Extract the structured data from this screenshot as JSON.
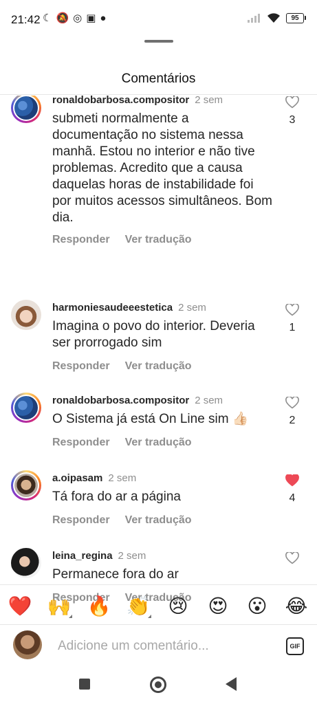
{
  "status_bar": {
    "time": "21:42",
    "left_icons": [
      "moon-icon",
      "mute-icon",
      "whatsapp-icon",
      "instagram-icon",
      "app-icon"
    ],
    "battery": "95"
  },
  "sheet": {
    "title": "Comentários"
  },
  "comments": [
    {
      "username": "ronaldobarbosa.compositor",
      "time": "2 sem",
      "text": "submeti normalmente a documentação no sistema nessa manhã. Estou no interior e não tive problemas. Acredito que a causa daquelas horas de instabilidade foi por muitos acessos simultâneos. Bom dia.",
      "likes": "3",
      "liked": false,
      "reply": "Responder",
      "translate": "Ver tradução"
    },
    {
      "username": "harmoniesaudeeestetica",
      "time": "2 sem",
      "text": "Imagina o povo do interior. Deveria ser prorrogado sim",
      "likes": "1",
      "liked": false,
      "reply": "Responder",
      "translate": "Ver tradução"
    },
    {
      "username": "ronaldobarbosa.compositor",
      "time": "2 sem",
      "text": "O Sistema já está On Line sim 👍🏻",
      "likes": "2",
      "liked": false,
      "reply": "Responder",
      "translate": "Ver tradução"
    },
    {
      "username": "a.oipasam",
      "time": "2 sem",
      "text": "Tá fora do ar a página",
      "likes": "4",
      "liked": true,
      "reply": "Responder",
      "translate": "Ver tradução"
    },
    {
      "username": "leina_regina",
      "time": "2 sem",
      "text": "Permanece fora do ar",
      "likes": "",
      "liked": false,
      "reply": "Responder",
      "translate": "Ver tradução"
    }
  ],
  "reactions": [
    "❤️",
    "🙌",
    "🔥",
    "👏",
    "😢",
    "😍",
    "😮",
    "😂"
  ],
  "composer": {
    "placeholder": "Adicione um comentário...",
    "gif_label": "GIF"
  },
  "colors": {
    "like_active": "#ed4956",
    "muted_text": "#8e8e8e"
  }
}
